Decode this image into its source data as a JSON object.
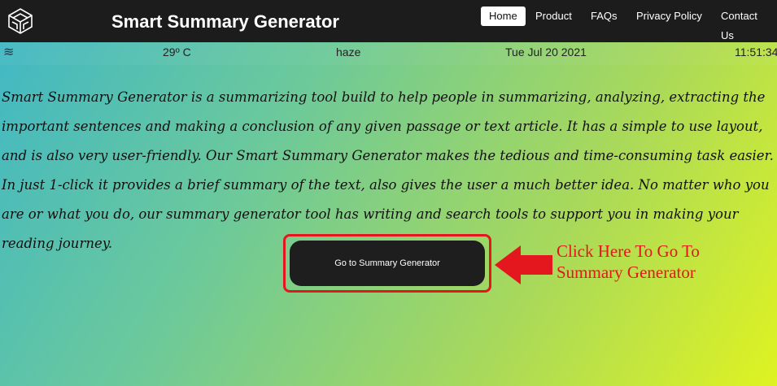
{
  "header": {
    "title": "Smart Summary Generator",
    "nav": [
      {
        "label": "Home",
        "active": true
      },
      {
        "label": "Product",
        "active": false
      },
      {
        "label": "FAQs",
        "active": false
      },
      {
        "label": "Privacy Policy",
        "active": false
      },
      {
        "label": "Contact Us",
        "active": false
      }
    ]
  },
  "weather": {
    "icon": "haze-icon",
    "temperature": "29º C",
    "condition": "haze",
    "date": "Tue Jul 20 2021",
    "time": "11:51:34"
  },
  "main": {
    "intro": "Smart Summary Generator is a summarizing tool build to help people in summarizing, analyzing, extracting the important sentences and making a conclusion of any given passage or text article. It has a simple to use layout, and is also very user-friendly. Our Smart Summary Generator makes the tedious and time-consuming task easier. In just 1-click it provides a brief summary of the text, also gives the user a much better idea. No matter who you are or what you do, our summary generator tool has writing and search tools to support you in making your reading journey.",
    "cta_label": "Go to Summary Generator",
    "callout_line1": "Click Here To Go To",
    "callout_line2": "Summary Generator"
  },
  "colors": {
    "navbar": "#1c1c1c",
    "annotation": "#e3171d",
    "button": "#1e1e1e"
  }
}
